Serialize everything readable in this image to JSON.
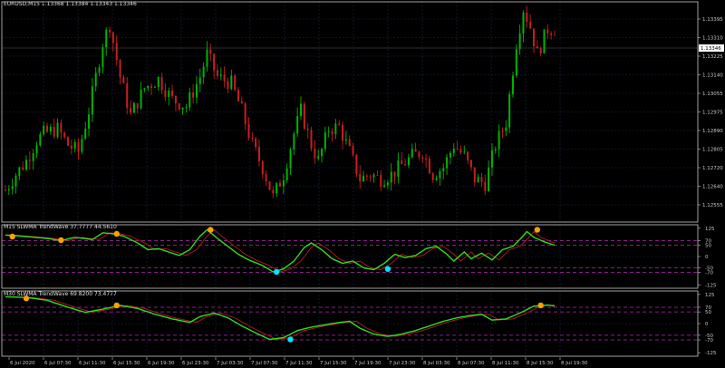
{
  "colors": {
    "bg": "#000000",
    "frame": "#c8c8c8",
    "grid": "#1a2a4a",
    "bull": "#00b400",
    "bear": "#c81e1e",
    "wave": "#32dc1e",
    "signal": "#b41e1e",
    "level": "#b428b4",
    "orange": "#ffa000",
    "cyan": "#00e5ff",
    "text": "#c8c8c8"
  },
  "main": {
    "title": "EURUSD,M15  1.13368 1.13384 1.13343 1.13346",
    "current_price": "1.13346",
    "price_ticks": [
      "1.13395",
      "1.13310",
      "1.13225",
      "1.13140",
      "1.13055",
      "1.12975",
      "1.12890",
      "1.12805",
      "1.12720",
      "1.12640",
      "1.12555"
    ],
    "ylim": [
      1.1251,
      1.1348
    ]
  },
  "ind1": {
    "title": "M15 SLWMA TrendWave 37.7777 44.5610",
    "ticks": [
      "125",
      "70",
      "50",
      "0",
      "-50",
      "-70",
      "-125"
    ],
    "ylim": [
      -140,
      140
    ],
    "levels": [
      70,
      50,
      -50,
      -70
    ]
  },
  "ind2": {
    "title": "M30 SLWMA TrendWave 69.8200 73.4777",
    "ticks": [
      "125",
      "70",
      "50",
      "0",
      "-50",
      "-70",
      "-125"
    ],
    "ylim": [
      -140,
      140
    ],
    "levels": [
      70,
      50,
      -50,
      -70
    ]
  },
  "time_axis": [
    "6 Jul 2020",
    "6 Jul 07:30",
    "6 Jul 11:30",
    "6 Jul 15:30",
    "6 Jul 19:30",
    "6 Jul 23:30",
    "7 Jul 03:30",
    "7 Jul 07:30",
    "7 Jul 11:30",
    "7 Jul 15:30",
    "7 Jul 19:30",
    "7 Jul 23:30",
    "8 Jul 03:30",
    "8 Jul 07:30",
    "8 Jul 11:30",
    "8 Jul 15:30",
    "8 Jul 19:30"
  ],
  "chart_data": [
    {
      "type": "candlestick",
      "anchors": [
        [
          0,
          1.1265
        ],
        [
          3,
          1.1272
        ],
        [
          6,
          1.1278
        ],
        [
          9,
          1.1287
        ],
        [
          11,
          1.129
        ],
        [
          15,
          1.1292
        ],
        [
          18,
          1.1285
        ],
        [
          21,
          1.1282
        ],
        [
          24,
          1.13
        ],
        [
          26,
          1.1315
        ],
        [
          28,
          1.133
        ],
        [
          30,
          1.1338
        ],
        [
          33,
          1.1315
        ],
        [
          36,
          1.1298
        ],
        [
          40,
          1.131
        ],
        [
          44,
          1.1314
        ],
        [
          48,
          1.1305
        ],
        [
          52,
          1.1302
        ],
        [
          56,
          1.1315
        ],
        [
          58,
          1.1325
        ],
        [
          61,
          1.1315
        ],
        [
          65,
          1.1312
        ],
        [
          68,
          1.13
        ],
        [
          71,
          1.1285
        ],
        [
          74,
          1.1275
        ],
        [
          77,
          1.1262
        ],
        [
          80,
          1.1272
        ],
        [
          83,
          1.129
        ],
        [
          85,
          1.13
        ],
        [
          88,
          1.1285
        ],
        [
          90,
          1.1278
        ],
        [
          93,
          1.1292
        ],
        [
          96,
          1.1293
        ],
        [
          99,
          1.1282
        ],
        [
          102,
          1.127
        ],
        [
          105,
          1.1272
        ],
        [
          108,
          1.127
        ],
        [
          111,
          1.1272
        ],
        [
          114,
          1.1276
        ],
        [
          117,
          1.128
        ],
        [
          120,
          1.1282
        ],
        [
          123,
          1.1272
        ],
        [
          126,
          1.1275
        ],
        [
          129,
          1.1285
        ],
        [
          132,
          1.128
        ],
        [
          135,
          1.127
        ],
        [
          138,
          1.1268
        ],
        [
          141,
          1.1285
        ],
        [
          144,
          1.1295
        ],
        [
          147,
          1.133
        ],
        [
          149,
          1.1345
        ],
        [
          151,
          1.1337
        ],
        [
          153,
          1.1325
        ],
        [
          156,
          1.1336
        ],
        [
          158,
          1.1336
        ]
      ]
    },
    {
      "type": "line",
      "name": "M15 SLWMA TrendWave",
      "anchors": [
        [
          0,
          95
        ],
        [
          6,
          88
        ],
        [
          12,
          80
        ],
        [
          16,
          70
        ],
        [
          20,
          85
        ],
        [
          25,
          75
        ],
        [
          28,
          105
        ],
        [
          31,
          100
        ],
        [
          34,
          90
        ],
        [
          38,
          60
        ],
        [
          41,
          30
        ],
        [
          44,
          35
        ],
        [
          47,
          20
        ],
        [
          50,
          5
        ],
        [
          53,
          30
        ],
        [
          56,
          90
        ],
        [
          58,
          118
        ],
        [
          61,
          80
        ],
        [
          64,
          45
        ],
        [
          67,
          10
        ],
        [
          70,
          -15
        ],
        [
          74,
          -40
        ],
        [
          77,
          -68
        ],
        [
          80,
          -55
        ],
        [
          83,
          -20
        ],
        [
          86,
          40
        ],
        [
          88,
          60
        ],
        [
          91,
          30
        ],
        [
          94,
          -10
        ],
        [
          97,
          -30
        ],
        [
          100,
          -20
        ],
        [
          103,
          -50
        ],
        [
          106,
          -58
        ],
        [
          109,
          -30
        ],
        [
          112,
          10
        ],
        [
          115,
          -5
        ],
        [
          118,
          5
        ],
        [
          121,
          35
        ],
        [
          124,
          45
        ],
        [
          127,
          10
        ],
        [
          129,
          -20
        ],
        [
          132,
          20
        ],
        [
          134,
          -10
        ],
        [
          137,
          15
        ],
        [
          140,
          -15
        ],
        [
          143,
          30
        ],
        [
          146,
          45
        ],
        [
          148,
          75
        ],
        [
          150,
          110
        ],
        [
          152,
          85
        ],
        [
          155,
          65
        ],
        [
          158,
          50
        ]
      ],
      "dots_orange": [
        [
          2,
          88
        ],
        [
          16,
          72
        ],
        [
          32,
          100
        ],
        [
          59,
          118
        ],
        [
          153,
          118
        ]
      ],
      "dots_cyan": [
        [
          78,
          -68
        ],
        [
          110,
          -55
        ]
      ]
    },
    {
      "type": "line",
      "name": "M30 SLWMA TrendWave",
      "anchors": [
        [
          0,
          115
        ],
        [
          6,
          112
        ],
        [
          12,
          100
        ],
        [
          18,
          70
        ],
        [
          23,
          48
        ],
        [
          28,
          62
        ],
        [
          33,
          78
        ],
        [
          38,
          65
        ],
        [
          43,
          40
        ],
        [
          48,
          20
        ],
        [
          53,
          5
        ],
        [
          56,
          30
        ],
        [
          60,
          45
        ],
        [
          64,
          25
        ],
        [
          68,
          -10
        ],
        [
          72,
          -40
        ],
        [
          76,
          -68
        ],
        [
          80,
          -60
        ],
        [
          84,
          -30
        ],
        [
          88,
          -15
        ],
        [
          92,
          -5
        ],
        [
          96,
          5
        ],
        [
          99,
          10
        ],
        [
          102,
          -20
        ],
        [
          106,
          -45
        ],
        [
          110,
          -55
        ],
        [
          114,
          -45
        ],
        [
          118,
          -30
        ],
        [
          122,
          -10
        ],
        [
          126,
          10
        ],
        [
          130,
          25
        ],
        [
          134,
          35
        ],
        [
          137,
          40
        ],
        [
          140,
          15
        ],
        [
          144,
          20
        ],
        [
          148,
          45
        ],
        [
          152,
          75
        ],
        [
          156,
          80
        ],
        [
          158,
          75
        ]
      ],
      "dots_orange": [
        [
          6,
          108
        ],
        [
          32,
          78
        ],
        [
          154,
          78
        ]
      ],
      "dots_cyan": [
        [
          82,
          -68
        ]
      ]
    }
  ]
}
